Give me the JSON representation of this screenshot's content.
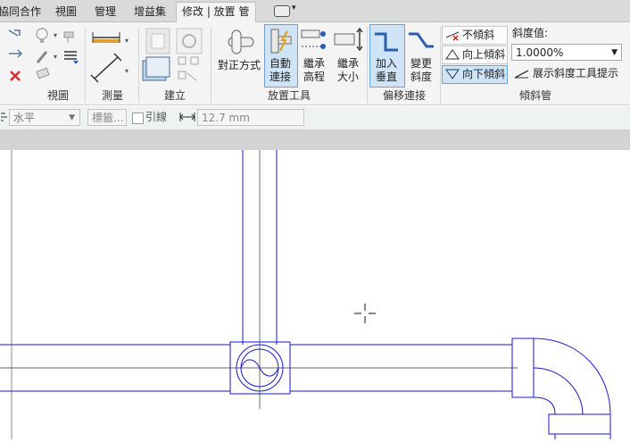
{
  "tabs": [
    {
      "label": "協同合作"
    },
    {
      "label": "視圖"
    },
    {
      "label": "管理"
    },
    {
      "label": "增益集"
    },
    {
      "label": "修改 | 放置 管"
    }
  ],
  "panels": {
    "view": "視圖",
    "measure": "測量",
    "build": "建立",
    "placement_tools": "放置工具",
    "offset_connect": "偏移連接",
    "slope_pipe": "傾斜管"
  },
  "placement_tools": {
    "justify": "對正方式",
    "auto_connect": [
      "自動",
      "連接"
    ],
    "inherit_elevation": [
      "繼承",
      "高程"
    ],
    "inherit_size": [
      "繼承",
      "大小"
    ]
  },
  "offset_connect": {
    "add_vertical": [
      "加入",
      "垂直"
    ],
    "change_slope": [
      "變更",
      "斜度"
    ]
  },
  "slope": {
    "no_slope": "不傾斜",
    "slope_up": "向上傾斜",
    "slope_down": "向下傾斜",
    "value_label": "斜度值:",
    "value": "1.0000%",
    "show_tooltip": "展示斜度工具提示"
  },
  "options_bar": {
    "orientation": "水平",
    "tag_placeholder": "標籤...",
    "leader_label": "引線",
    "leader_length": "12.7 mm"
  },
  "colors": {
    "pipe": "#1a1acc",
    "active_bg": "#cfe4f7",
    "active_border": "#6aa3d6"
  }
}
